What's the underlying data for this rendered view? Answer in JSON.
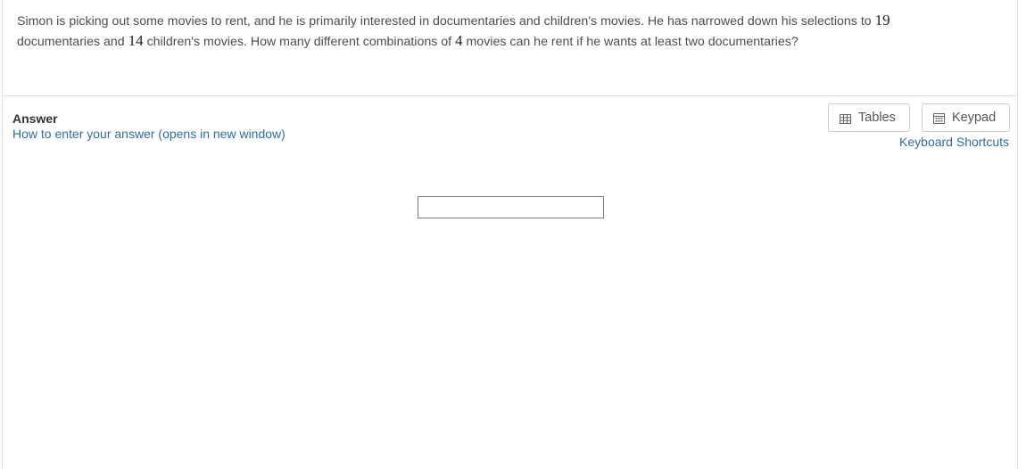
{
  "question": {
    "part1": "Simon is picking out some movies to rent, and he is primarily interested in documentaries and children's movies.  He has narrowed down his selections to ",
    "num_documentaries": "19",
    "part2": "documentaries and ",
    "num_childrens": "14",
    "part3": " children's movies.  How many different combinations of ",
    "num_movies": "4",
    "part4": " movies can he rent if he wants at least two documentaries?"
  },
  "answer": {
    "label": "Answer",
    "help_link": "How to enter your answer (opens in new window)",
    "input_value": ""
  },
  "tools": {
    "tables_label": "Tables",
    "keypad_label": "Keypad",
    "shortcuts_label": "Keyboard Shortcuts"
  },
  "colors": {
    "link": "#2e6da4",
    "text": "#4d4d4d",
    "border": "#cccccc"
  },
  "icons": {
    "tables": "table-grid-icon",
    "keypad": "calculator-icon"
  }
}
